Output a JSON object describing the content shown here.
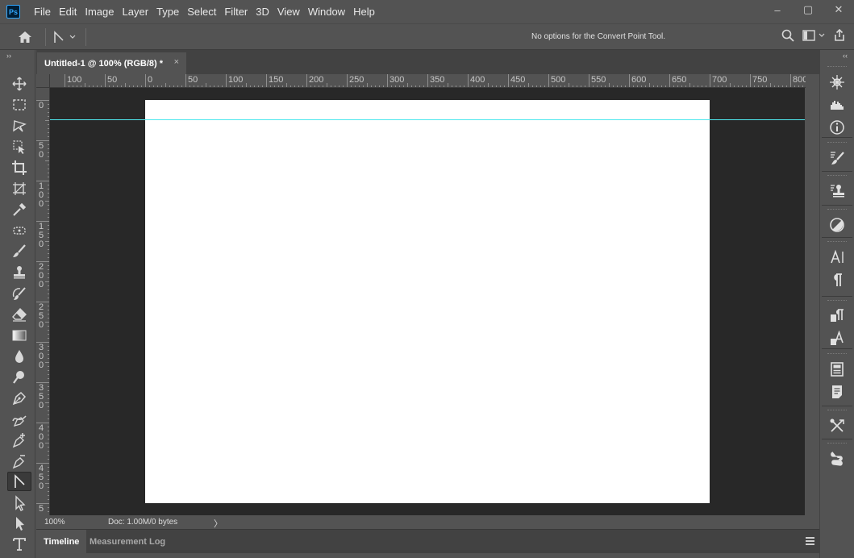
{
  "app": {
    "logo_text": "Ps"
  },
  "menu": {
    "items": [
      "File",
      "Edit",
      "Image",
      "Layer",
      "Type",
      "Select",
      "Filter",
      "3D",
      "View",
      "Window",
      "Help"
    ]
  },
  "window_controls": {
    "minimize": "–",
    "restore": "▢",
    "close": "✕"
  },
  "options_bar": {
    "message": "No options for the Convert Point Tool."
  },
  "document": {
    "tab_title": "Untitled-1 @ 100% (RGB/8) *",
    "close_glyph": "×",
    "ruler_h_labels": [
      "100",
      "50",
      "0",
      "50",
      "100",
      "150",
      "200",
      "250",
      "300",
      "350",
      "400",
      "450",
      "500",
      "550",
      "600",
      "650",
      "700",
      "750",
      "800"
    ],
    "ruler_v_labels": [
      "0",
      "5\n0",
      "1\n0\n0",
      "1\n5\n0",
      "2\n0\n0",
      "2\n5\n0",
      "3\n0\n0",
      "3\n5\n0",
      "4\n0\n0",
      "4\n5\n0",
      "5"
    ]
  },
  "status": {
    "zoom": "100%",
    "doc_info": "Doc: 1.00M/0 bytes",
    "arrow": "〉"
  },
  "bottom_panel": {
    "tabs": [
      "Timeline",
      "Measurement Log"
    ],
    "active_tab": "Timeline"
  },
  "toolbar": {
    "collapse_glyph": "››",
    "tools": [
      "move-tool",
      "rectangular-marquee-tool",
      "lasso-tool",
      "object-selection-tool",
      "crop-tool",
      "frame-tool",
      "eyedropper-tool",
      "spot-healing-tool",
      "brush-tool",
      "clone-stamp-tool",
      "history-brush-tool",
      "eraser-tool",
      "gradient-tool",
      "blur-tool",
      "dodge-tool",
      "pen-tool",
      "freeform-pen-tool",
      "add-anchor-point-tool",
      "delete-anchor-point-tool",
      "convert-point-tool",
      "path-selection-tool",
      "direct-selection-tool",
      "type-tool"
    ],
    "active_tool": "convert-point-tool"
  },
  "right_dock": {
    "collapse_glyph": "‹‹",
    "panels": [
      "navigator",
      "histogram",
      "info",
      "brushes",
      "clone-source",
      "adjustments",
      "character",
      "paragraph",
      "character-styles",
      "paragraph-styles",
      "properties",
      "notes",
      "tool-presets",
      "actions"
    ]
  },
  "colors": {
    "guide": "#4fe8ee",
    "canvas_bg": "#282828",
    "ui_bg": "#535353",
    "ps_blue": "#31a8ff"
  }
}
